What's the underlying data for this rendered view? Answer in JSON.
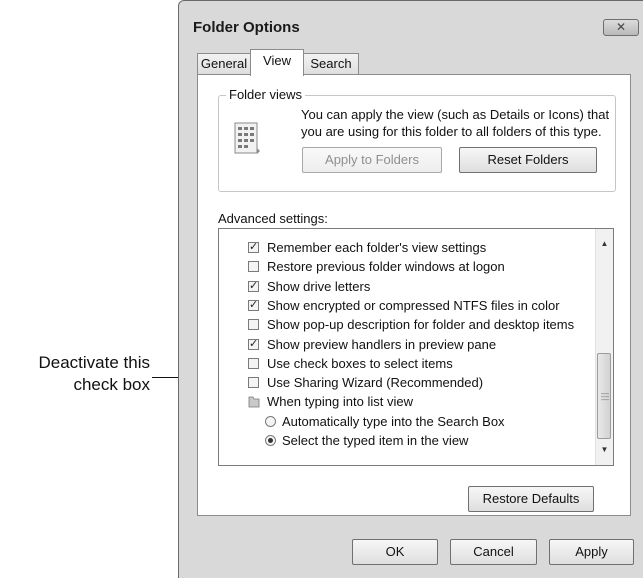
{
  "callout": {
    "line1": "Deactivate this",
    "line2": "check box"
  },
  "window": {
    "title": "Folder Options",
    "close_label": "✕"
  },
  "tabs": [
    {
      "label": "General",
      "active": false
    },
    {
      "label": "View",
      "active": true
    },
    {
      "label": "Search",
      "active": false
    }
  ],
  "folder_views": {
    "legend": "Folder views",
    "description": "You can apply the view (such as Details or Icons) that you are using for this folder to all folders of this type.",
    "apply_label": "Apply to Folders",
    "reset_label": "Reset Folders",
    "icon": "folder-view-icon"
  },
  "advanced": {
    "label": "Advanced settings:",
    "items": [
      {
        "type": "checkbox",
        "label": "Remember each folder's view settings",
        "checked": true
      },
      {
        "type": "checkbox",
        "label": "Restore previous folder windows at logon",
        "checked": false
      },
      {
        "type": "checkbox",
        "label": "Show drive letters",
        "checked": true
      },
      {
        "type": "checkbox",
        "label": "Show encrypted or compressed NTFS files in color",
        "checked": true
      },
      {
        "type": "checkbox",
        "label": "Show pop-up description for folder and desktop items",
        "checked": false
      },
      {
        "type": "checkbox",
        "label": "Show preview handlers in preview pane",
        "checked": true
      },
      {
        "type": "checkbox",
        "label": "Use check boxes to select items",
        "checked": false
      },
      {
        "type": "checkbox",
        "label": "Use Sharing Wizard (Recommended)",
        "checked": false
      },
      {
        "type": "folder",
        "label": "When typing into list view"
      },
      {
        "type": "radio",
        "label": "Automatically type into the Search Box",
        "checked": false
      },
      {
        "type": "radio",
        "label": "Select the typed item in the view",
        "checked": true
      }
    ]
  },
  "buttons": {
    "restore_defaults": "Restore Defaults",
    "ok": "OK",
    "cancel": "Cancel",
    "apply": "Apply"
  }
}
